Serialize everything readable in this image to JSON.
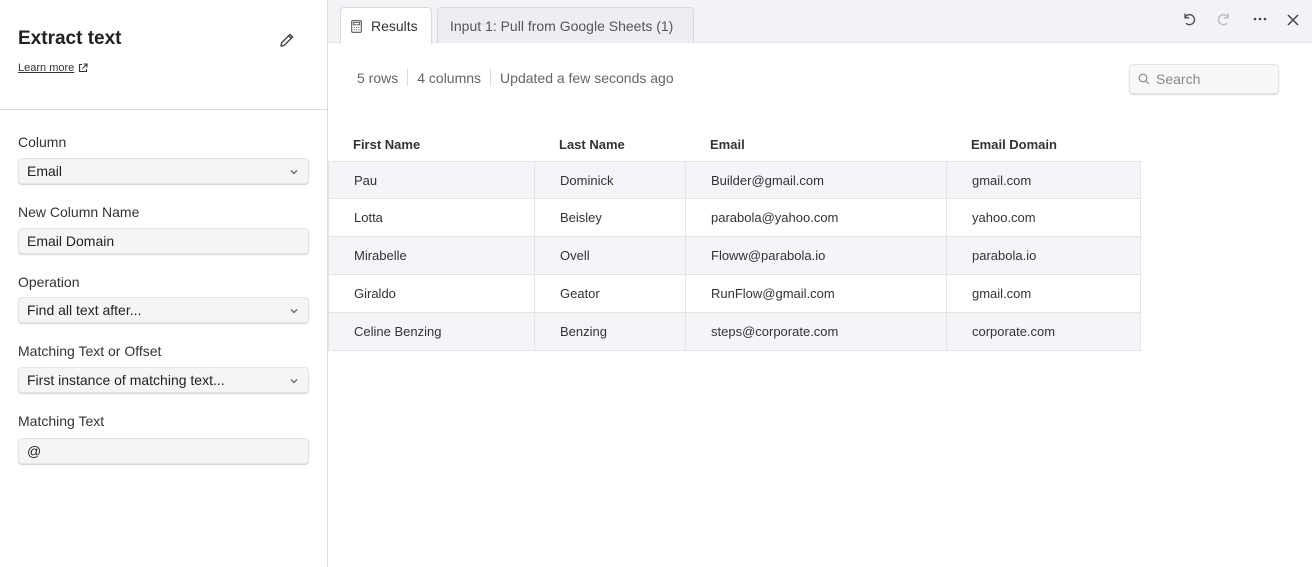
{
  "panel": {
    "title": "Extract text",
    "learn_more": "Learn more",
    "fields": {
      "column": {
        "label": "Column",
        "value": "Email"
      },
      "new_column_name": {
        "label": "New Column Name",
        "value": "Email Domain"
      },
      "operation": {
        "label": "Operation",
        "value": "Find all text after..."
      },
      "matching_offset": {
        "label": "Matching Text or Offset",
        "value": "First instance of matching text..."
      },
      "matching_text": {
        "label": "Matching Text",
        "value": "@"
      }
    }
  },
  "tabs": {
    "results": "Results",
    "input": "Input 1: Pull from Google Sheets (1)"
  },
  "toolbar_icons": [
    "undo-icon",
    "redo-icon",
    "more-icon",
    "close-icon"
  ],
  "summary": {
    "rows": "5 rows",
    "columns": "4 columns",
    "updated": "Updated a few seconds ago"
  },
  "search": {
    "placeholder": "Search"
  },
  "table": {
    "headers": [
      "First Name",
      "Last Name",
      "Email",
      "Email Domain"
    ],
    "rows": [
      [
        "Pau",
        "Dominick",
        "Builder@gmail.com",
        "gmail.com"
      ],
      [
        "Lotta",
        "Beisley",
        "parabola@yahoo.com",
        "yahoo.com"
      ],
      [
        "Mirabelle",
        "Ovell",
        "Floww@parabola.io",
        "parabola.io"
      ],
      [
        "Giraldo",
        "Geator",
        "RunFlow@gmail.com",
        "gmail.com"
      ],
      [
        "Celine Benzing",
        "Benzing",
        "steps@corporate.com",
        "corporate.com"
      ]
    ]
  },
  "colors": {
    "panel_border": "#dcdcdc",
    "tabbar_bg": "#f1f3f6",
    "row_shade": "#f3f5f8",
    "input_bg": "#f4f5f7"
  }
}
